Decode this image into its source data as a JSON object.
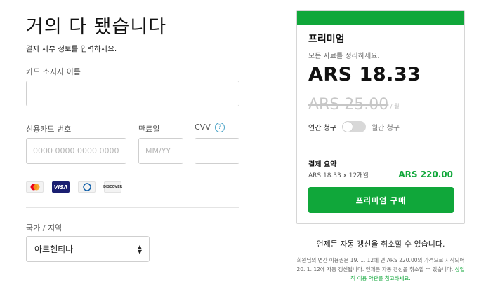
{
  "header": {
    "title": "거의 다 됐습니다",
    "subtitle": "결제 세부 정보를 입력하세요."
  },
  "form": {
    "cardholder": {
      "label": "카드 소지자 이름",
      "value": ""
    },
    "card_number": {
      "label": "신용카드 번호",
      "placeholder": "0000 0000 0000 0000"
    },
    "expiry": {
      "label": "만료일",
      "placeholder": "MM/YY"
    },
    "cvv": {
      "label": "CVV",
      "help_glyph": "?"
    },
    "card_brands": [
      {
        "name": "mastercard"
      },
      {
        "name": "visa",
        "text": "VISA"
      },
      {
        "name": "diners"
      },
      {
        "name": "discover",
        "text": "DISCOVER"
      }
    ],
    "country": {
      "label": "국가 / 지역",
      "value": "아르헨티나"
    }
  },
  "plan": {
    "name": "프리미엄",
    "description": "모든 자료를 정리하세요.",
    "price": "ARS 18.33",
    "old_price": "ARS 25.00",
    "per": "/ 월",
    "billing_annual": "연간 청구",
    "billing_monthly": "월간 청구",
    "toggle_on": false,
    "summary_title": "결제 요약",
    "summary_line": "ARS 18.33 x 12개월",
    "summary_total": "ARS 220.00",
    "buy_label": "프리미엄 구매"
  },
  "footer": {
    "cancel_note": "언제든 자동 갱신을 취소할 수 있습니다.",
    "fine_print": "회원님의 연간 이용권은 19. 1. 12에 연 ARS 220.00의 가격으로 시작되어 20. 1. 12에 자동 갱신됩니다. 언제든 자동 갱신을 취소할 수 있습니다. ",
    "terms_link": "상업적 이용 약관를 참고하세요."
  },
  "colors": {
    "accent": "#10a73a",
    "visa": "#1a1f71"
  }
}
